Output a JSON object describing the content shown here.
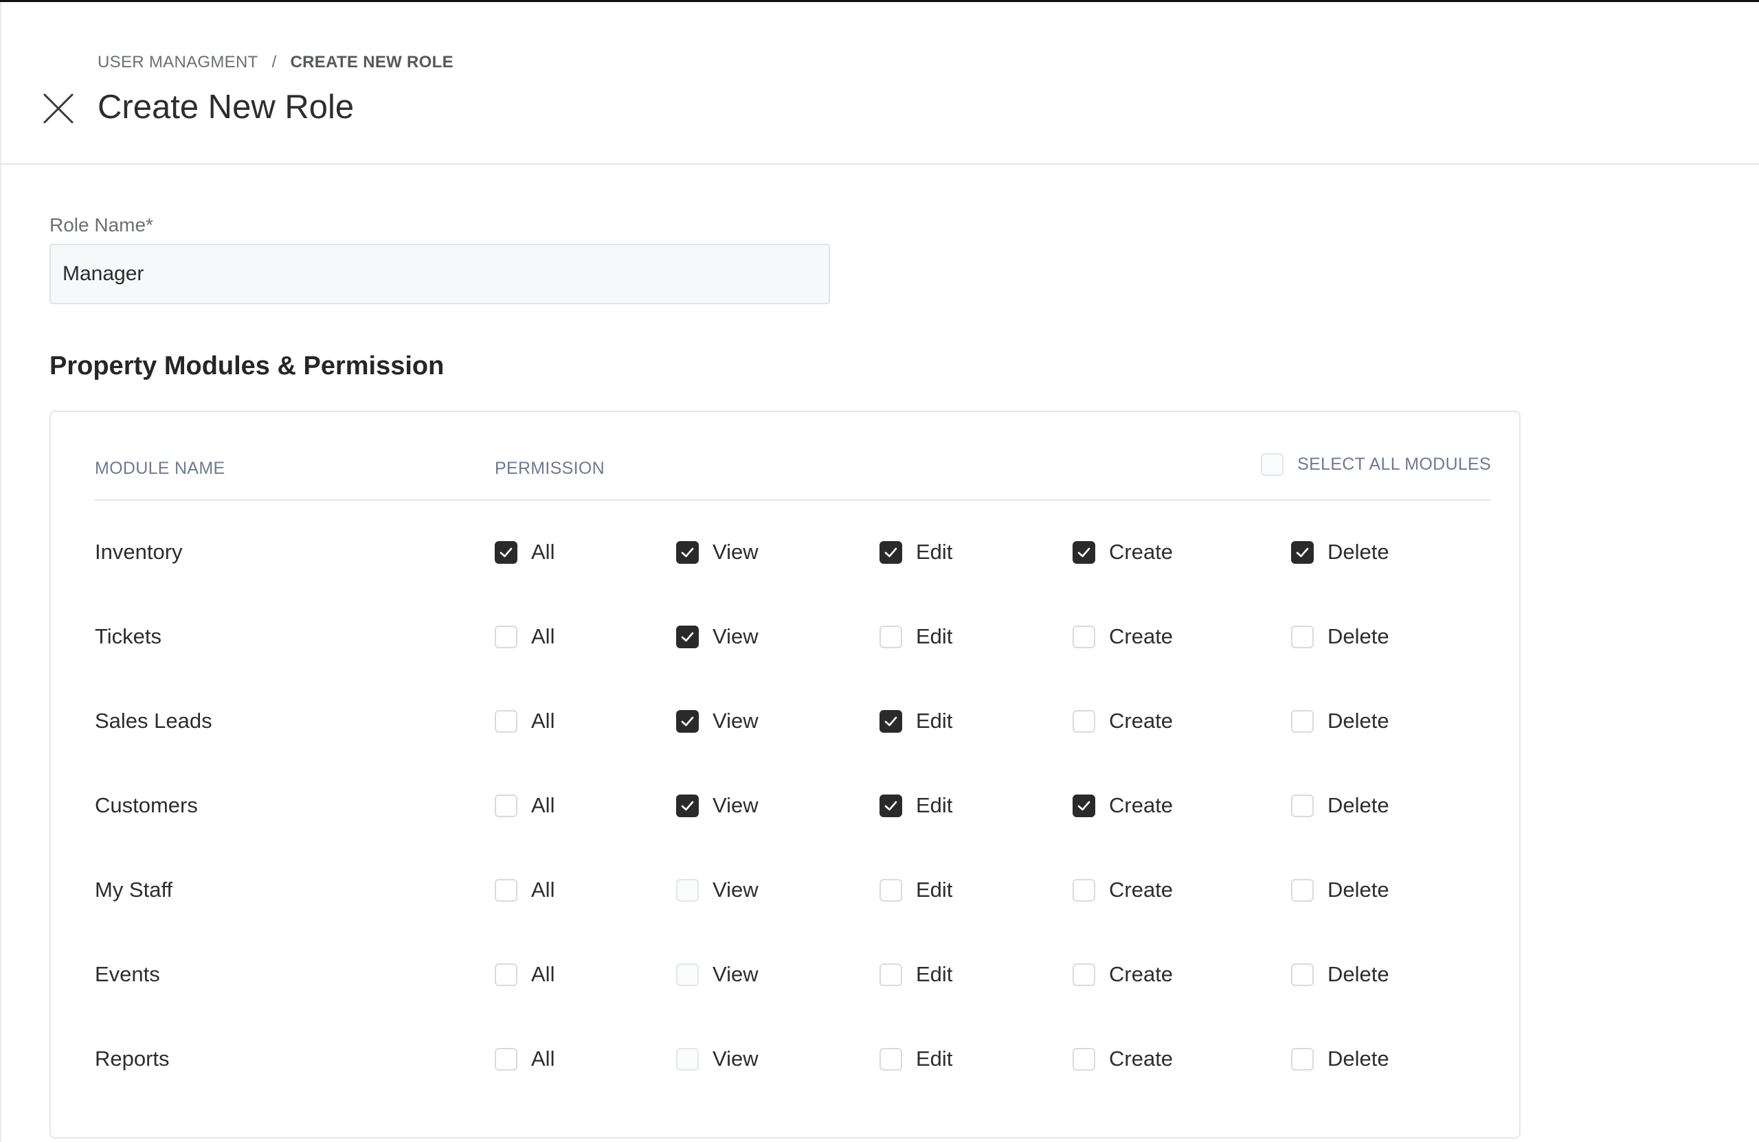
{
  "breadcrumb": {
    "parent": "USER MANAGMENT",
    "separator": "/",
    "current": "CREATE NEW ROLE"
  },
  "page": {
    "title": "Create New Role",
    "close_icon": "close-icon"
  },
  "form": {
    "role_name_label": "Role Name*",
    "role_name_value": "Manager"
  },
  "permissions_section": {
    "title": "Property Modules & Permission",
    "headers": {
      "module": "MODULE NAME",
      "permission": "PERMISSION",
      "select_all": "SELECT ALL MODULES"
    },
    "select_all_checked": false,
    "permission_labels": [
      "All",
      "View",
      "Edit",
      "Create",
      "Delete"
    ],
    "modules": [
      {
        "name": "Inventory",
        "checked": [
          true,
          true,
          true,
          true,
          true
        ]
      },
      {
        "name": "Tickets",
        "checked": [
          false,
          true,
          false,
          false,
          false
        ]
      },
      {
        "name": "Sales Leads",
        "checked": [
          false,
          true,
          true,
          false,
          false
        ]
      },
      {
        "name": "Customers",
        "checked": [
          false,
          true,
          true,
          true,
          false
        ]
      },
      {
        "name": "My Staff",
        "checked": [
          false,
          false,
          false,
          false,
          false
        ]
      },
      {
        "name": "Events",
        "checked": [
          false,
          false,
          false,
          false,
          false
        ]
      },
      {
        "name": "Reports",
        "checked": [
          false,
          false,
          false,
          false,
          false
        ]
      }
    ]
  },
  "colors": {
    "checkbox_checked": "#2a2a2a",
    "header_text": "#6d7a95",
    "border": "#e4e6ea"
  }
}
